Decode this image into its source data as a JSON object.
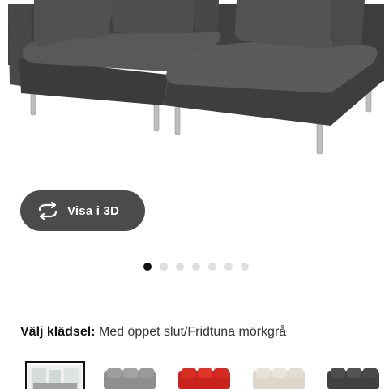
{
  "product": {
    "image_alt": "Soderhamn sofa dark grey",
    "view3d_label": "Visa i 3D"
  },
  "carousel": {
    "total_dots": 7,
    "active_index": 0
  },
  "fabric": {
    "label": "Välj klädsel:",
    "value": "Med öppet slut/Fridtuna mörkgrå"
  },
  "swatches": [
    {
      "name": "room-photo",
      "selected": true
    },
    {
      "name": "grey",
      "color": "#8e8e8e"
    },
    {
      "name": "red",
      "color": "#d42a22"
    },
    {
      "name": "beige",
      "color": "#e4ded2"
    },
    {
      "name": "dark-grey",
      "color": "#4a4a4c"
    }
  ],
  "colors": {
    "sofa": "#4a4b4d",
    "button_bg": "#4b4b4b",
    "dot_active": "#111111",
    "dot_inactive": "#dfdfdf"
  }
}
